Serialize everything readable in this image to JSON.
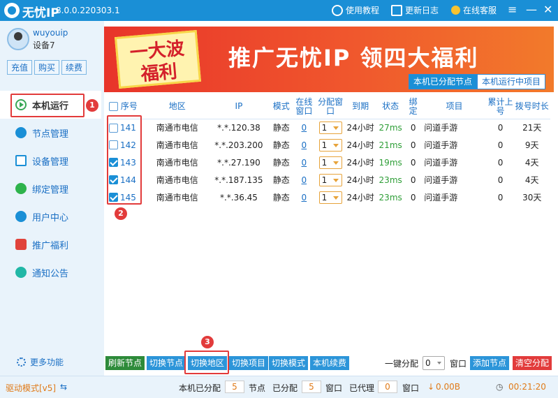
{
  "titlebar": {
    "app_name": "无忧IP",
    "version": "8.0.0.220303.1",
    "tutorial_label": "使用教程",
    "changelog_label": "更新日志",
    "service_label": "在线客服",
    "menu_icon": "menu-icon",
    "min_icon": "minimize-icon",
    "close_icon": "close-icon"
  },
  "user": {
    "name": "wuyouip",
    "device": "设备7",
    "buttons": [
      "充值",
      "购买",
      "续费"
    ]
  },
  "nav": {
    "items": [
      "本机运行",
      "节点管理",
      "设备管理",
      "绑定管理",
      "用户中心",
      "推广福利",
      "通知公告"
    ],
    "more": "更多功能"
  },
  "banner": {
    "big_text_1": "一大波",
    "big_text_2": "福利",
    "slogan": "推广无忧IP 领四大福利"
  },
  "tabs": [
    "本机已分配节点",
    "本机运行中项目"
  ],
  "table": {
    "headers": [
      "序号",
      "地区",
      "IP",
      "模式",
      "在线窗口",
      "分配窗口",
      "到期",
      "状态",
      "绑定",
      "项目",
      "累计上号",
      "拨号时长"
    ],
    "rows": [
      {
        "id": "141",
        "checked": false,
        "region": "南通市电信",
        "ip": "*.*.120.38",
        "mode": "静态",
        "online": "0",
        "alloc": "1",
        "expire": "24小时",
        "status": "27ms",
        "bind": "0",
        "project": "问道手游",
        "total": "0",
        "duration": "21天"
      },
      {
        "id": "142",
        "checked": false,
        "region": "南通市电信",
        "ip": "*.*.203.200",
        "mode": "静态",
        "online": "0",
        "alloc": "1",
        "expire": "24小时",
        "status": "21ms",
        "bind": "0",
        "project": "问道手游",
        "total": "0",
        "duration": "9天"
      },
      {
        "id": "143",
        "checked": true,
        "region": "南通市电信",
        "ip": "*.*.27.190",
        "mode": "静态",
        "online": "0",
        "alloc": "1",
        "expire": "24小时",
        "status": "19ms",
        "bind": "0",
        "project": "问道手游",
        "total": "0",
        "duration": "4天"
      },
      {
        "id": "144",
        "checked": true,
        "region": "南通市电信",
        "ip": "*.*.187.135",
        "mode": "静态",
        "online": "0",
        "alloc": "1",
        "expire": "24小时",
        "status": "23ms",
        "bind": "0",
        "project": "问道手游",
        "total": "0",
        "duration": "4天"
      },
      {
        "id": "145",
        "checked": true,
        "region": "南通市电信",
        "ip": "*.*.36.45",
        "mode": "静态",
        "online": "0",
        "alloc": "1",
        "expire": "24小时",
        "status": "23ms",
        "bind": "0",
        "project": "问道手游",
        "total": "0",
        "duration": "30天"
      }
    ]
  },
  "bottom": {
    "refresh": "刷新节点",
    "switch_node": "切换节点",
    "switch_region": "切换地区",
    "switch_project": "切换项目",
    "switch_mode": "切换模式",
    "renew": "本机续费",
    "one_key": "一键分配",
    "one_key_value": "0",
    "window": "窗口",
    "add_node": "添加节点",
    "clear": "清空分配"
  },
  "status": {
    "driver_mode": "驱动模式[v5]",
    "allocated_label": "本机已分配",
    "allocated_value": "5",
    "node_label": "节点",
    "assigned_label": "已分配",
    "assigned_value": "5",
    "window_label": "窗口",
    "proxy_label": "已代理",
    "proxy_value": "0",
    "window_label2": "窗口",
    "traffic": "0.00B",
    "timer": "00:21:20"
  },
  "annotations": [
    "1",
    "2",
    "3"
  ]
}
